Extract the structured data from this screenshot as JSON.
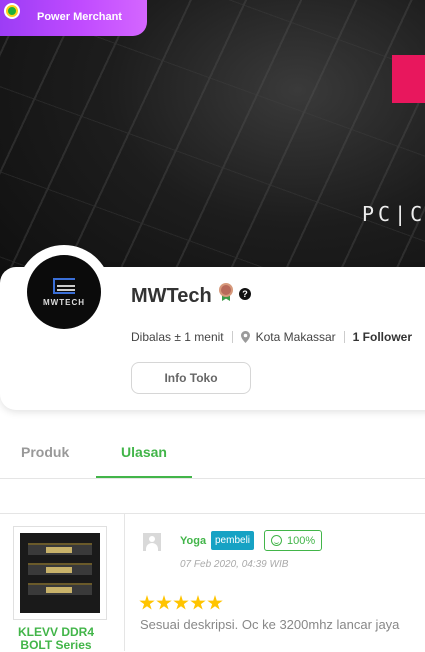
{
  "banner": {
    "badge_label": "Power Merchant",
    "brand_text": "PC|C",
    "accent_color": "#e8175d"
  },
  "shop": {
    "name": "MWTech",
    "avatar_text": "MWTECH",
    "response_time": "Dibalas ± 1 menit",
    "location": "Kota Makassar",
    "followers": "1 Follower",
    "info_button": "Info Toko"
  },
  "tabs": [
    {
      "label": "Produk",
      "active": false
    },
    {
      "label": "Ulasan",
      "active": true
    }
  ],
  "review": {
    "product_name": "KLEVV DDR4 BOLT Series",
    "reviewer": "Yoga",
    "reviewer_badge": "pembeli",
    "reputation": "100%",
    "date": "07 Feb 2020, 04:39 WIB",
    "rating": 5,
    "text": "Sesuai deskripsi. Oc ke 3200mhz lancar jaya"
  },
  "colors": {
    "primary_green": "#42b549",
    "badge_purple": "#b045fb",
    "buyer_badge": "#16a2c4",
    "star": "#ffc400"
  },
  "icons": [
    "power-merchant-icon",
    "medal-icon",
    "help-icon",
    "location-pin-icon",
    "user-avatar-icon",
    "smile-icon",
    "star-icon"
  ]
}
